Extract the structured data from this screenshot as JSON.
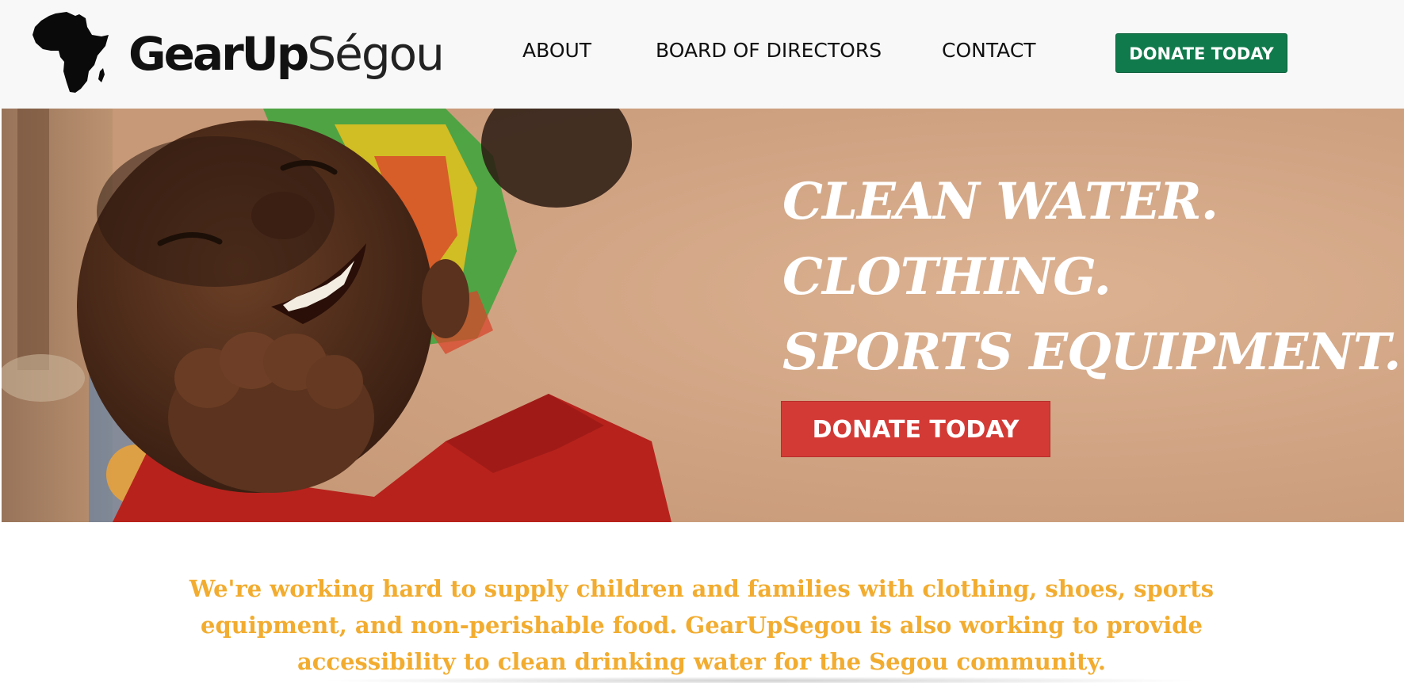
{
  "brand": {
    "name_bold": "GearUp",
    "name_light": "Ségou",
    "logo_icon": "africa-continent-icon"
  },
  "nav": {
    "about": "ABOUT",
    "board": "BOARD OF DIRECTORS",
    "contact": "CONTACT",
    "donate": "DONATE TODAY"
  },
  "hero": {
    "lines": [
      "CLEAN WATER.",
      "CLOTHING.",
      "SPORTS EQUIPMENT."
    ],
    "donate": "DONATE TODAY"
  },
  "mission": {
    "text": "We're working hard to supply children and families with clothing, shoes, sports equipment, and non-perishable food. GearUpSegou is also working to provide accessibility to clean drinking water for the Segou community."
  },
  "colors": {
    "header_bg": "#f8f8f8",
    "header_donate_bg": "#117a4c",
    "hero_donate_bg": "#d33a36",
    "mission_text": "#f2ac2f"
  }
}
